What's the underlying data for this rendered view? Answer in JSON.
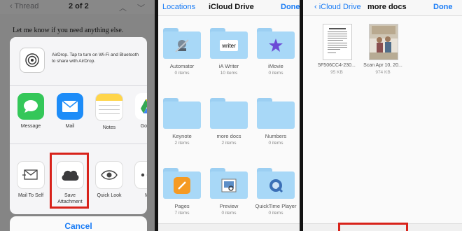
{
  "mail": {
    "back_label": "Thread",
    "counter": "2 of 2",
    "body_text": "Let me know if you need anything else."
  },
  "share_sheet": {
    "airdrop_text": "AirDrop. Tap to turn on Wi-Fi and Bluetooth to share with AirDrop.",
    "apps": [
      {
        "label": "Message",
        "icon": "message-icon",
        "color": "#34c759"
      },
      {
        "label": "Mail",
        "icon": "mail-icon",
        "color": "#1d8cf8"
      },
      {
        "label": "Notes",
        "icon": "notes-icon",
        "color": "#ffd54a"
      },
      {
        "label": "Google",
        "icon": "google-drive-icon",
        "color": "#ffffff"
      }
    ],
    "actions": [
      {
        "label": "Mail To Self",
        "icon": "mail-to-self-icon"
      },
      {
        "label": "Save Attachment",
        "icon": "cloud-icon"
      },
      {
        "label": "Quick Look",
        "icon": "eye-icon"
      },
      {
        "label": "Mo",
        "icon": "more-icon"
      }
    ],
    "cancel_label": "Cancel"
  },
  "icloud": {
    "nav_left": "Locations",
    "nav_title": "iCloud Drive",
    "nav_right": "Done",
    "folders": [
      {
        "name": "Automator",
        "count": "0 items",
        "emblem": "automator-icon"
      },
      {
        "name": "iA Writer",
        "count": "10 items",
        "emblem": "writer-icon",
        "emblem_text": "writer"
      },
      {
        "name": "iMovie",
        "count": "0 items",
        "emblem": "imovie-icon"
      },
      {
        "name": "Keynote",
        "count": "2 items",
        "emblem": "none"
      },
      {
        "name": "more docs",
        "count": "2 items",
        "emblem": "none"
      },
      {
        "name": "Numbers",
        "count": "0 items",
        "emblem": "none"
      },
      {
        "name": "Pages",
        "count": "7 items",
        "emblem": "pages-icon"
      },
      {
        "name": "Preview",
        "count": "0 items",
        "emblem": "preview-icon"
      },
      {
        "name": "QuickTime Player",
        "count": "0 items",
        "emblem": "quicktime-icon"
      }
    ]
  },
  "more_docs": {
    "nav_back": "iCloud Drive",
    "nav_title": "more docs",
    "nav_right": "Done",
    "files": [
      {
        "name": "5F506CC4-230...",
        "size": "95 KB",
        "kind": "document"
      },
      {
        "name": "Scan Apr 10, 20...",
        "size": "974 KB",
        "kind": "photo"
      }
    ]
  },
  "colors": {
    "accent": "#1a7cf5",
    "highlight": "#d8221a",
    "folder": "#a8d8f7"
  }
}
